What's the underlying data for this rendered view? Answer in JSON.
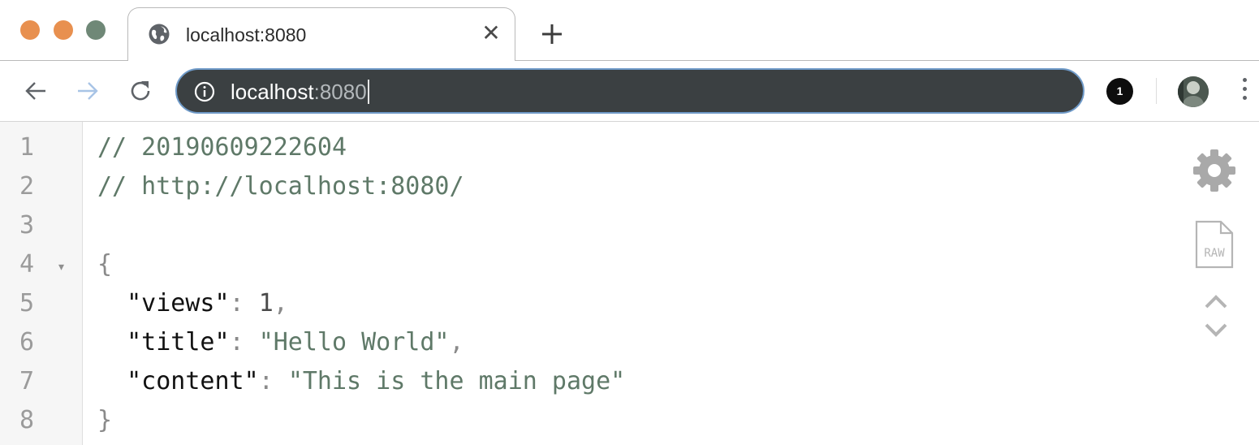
{
  "window": {
    "traffic_colors": {
      "close": "#e8904f",
      "minimize": "#e8904f",
      "maximize": "#6f8877"
    }
  },
  "tab": {
    "favicon": "globe-icon",
    "title": "localhost:8080",
    "close_icon": "close-icon"
  },
  "new_tab_icon": "plus-icon",
  "toolbar": {
    "back_icon": "arrow-left-icon",
    "forward_icon": "arrow-right-icon",
    "reload_icon": "reload-icon",
    "omnibox": {
      "info_icon": "info-icon",
      "host": "localhost",
      "port": ":8080"
    },
    "extension_badge": "1",
    "menu_icon": "more-vertical-icon"
  },
  "editor": {
    "line_numbers": [
      "1",
      "2",
      "3",
      "4",
      "5",
      "6",
      "7",
      "8"
    ],
    "lines": {
      "comment_timestamp": "// 20190609222604",
      "comment_url": "// http://localhost:8080/",
      "open_brace": "{",
      "views_key": "\"views\"",
      "views_value": "1",
      "title_key": "\"title\"",
      "title_value": "\"Hello World\"",
      "content_key": "\"content\"",
      "content_value": "\"This is the main page\"",
      "close_brace": "}",
      "colon": ":",
      "comma": ","
    },
    "fold_marker": "▾",
    "tools": {
      "settings_icon": "gear-icon",
      "raw_icon": "raw-file-icon",
      "raw_label": "RAW",
      "prev_icon": "chevron-up-icon",
      "next_icon": "chevron-down-icon"
    }
  }
}
